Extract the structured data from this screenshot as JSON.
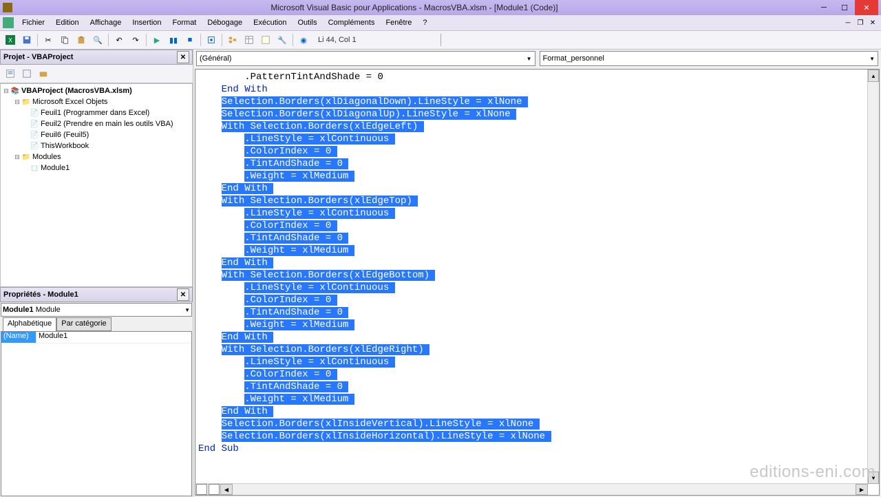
{
  "title": "Microsoft Visual Basic pour Applications - MacrosVBA.xlsm - [Module1 (Code)]",
  "menu": [
    "Fichier",
    "Edition",
    "Affichage",
    "Insertion",
    "Format",
    "Débogage",
    "Exécution",
    "Outils",
    "Compléments",
    "Fenêtre",
    "?"
  ],
  "cursor_status": "Li 44, Col 1",
  "project_panel": {
    "title": "Projet - VBAProject"
  },
  "tree": {
    "root": "VBAProject (MacrosVBA.xlsm)",
    "folder1": "Microsoft Excel Objets",
    "sheets": [
      "Feuil1 (Programmer dans Excel)",
      "Feuil2 (Prendre en main les outils VBA)",
      "Feuil6 (Feuil5)",
      "ThisWorkbook"
    ],
    "folder2": "Modules",
    "module": "Module1"
  },
  "props_panel": {
    "title": "Propriétés - Module1"
  },
  "props_combo": {
    "name": "Module1",
    "type": "Module"
  },
  "props_tabs": [
    "Alphabétique",
    "Par catégorie"
  ],
  "props_rows": [
    {
      "name": "(Name)",
      "value": "Module1"
    }
  ],
  "code_combos": {
    "left": "(Général)",
    "right": "Format_personnel"
  },
  "code": [
    {
      "indent": 8,
      "t": ".PatternTintAndShade = 0",
      "sel": false
    },
    {
      "indent": 4,
      "t": "End With",
      "sel": false,
      "kw": true
    },
    {
      "indent": 4,
      "t": "Selection.Borders(xlDiagonalDown).LineStyle = xlNone",
      "sel": true
    },
    {
      "indent": 4,
      "t": "Selection.Borders(xlDiagonalUp).LineStyle = xlNone",
      "sel": true
    },
    {
      "indent": 4,
      "t": "With Selection.Borders(xlEdgeLeft)",
      "sel": true
    },
    {
      "indent": 8,
      "t": ".LineStyle = xlContinuous",
      "sel": true
    },
    {
      "indent": 8,
      "t": ".ColorIndex = 0",
      "sel": true
    },
    {
      "indent": 8,
      "t": ".TintAndShade = 0",
      "sel": true
    },
    {
      "indent": 8,
      "t": ".Weight = xlMedium",
      "sel": true
    },
    {
      "indent": 4,
      "t": "End With",
      "sel": true
    },
    {
      "indent": 4,
      "t": "With Selection.Borders(xlEdgeTop)",
      "sel": true
    },
    {
      "indent": 8,
      "t": ".LineStyle = xlContinuous",
      "sel": true
    },
    {
      "indent": 8,
      "t": ".ColorIndex = 0",
      "sel": true
    },
    {
      "indent": 8,
      "t": ".TintAndShade = 0",
      "sel": true
    },
    {
      "indent": 8,
      "t": ".Weight = xlMedium",
      "sel": true
    },
    {
      "indent": 4,
      "t": "End With",
      "sel": true
    },
    {
      "indent": 4,
      "t": "With Selection.Borders(xlEdgeBottom)",
      "sel": true
    },
    {
      "indent": 8,
      "t": ".LineStyle = xlContinuous",
      "sel": true
    },
    {
      "indent": 8,
      "t": ".ColorIndex = 0",
      "sel": true
    },
    {
      "indent": 8,
      "t": ".TintAndShade = 0",
      "sel": true
    },
    {
      "indent": 8,
      "t": ".Weight = xlMedium",
      "sel": true
    },
    {
      "indent": 4,
      "t": "End With",
      "sel": true
    },
    {
      "indent": 4,
      "t": "With Selection.Borders(xlEdgeRight)",
      "sel": true
    },
    {
      "indent": 8,
      "t": ".LineStyle = xlContinuous",
      "sel": true
    },
    {
      "indent": 8,
      "t": ".ColorIndex = 0",
      "sel": true
    },
    {
      "indent": 8,
      "t": ".TintAndShade = 0",
      "sel": true
    },
    {
      "indent": 8,
      "t": ".Weight = xlMedium",
      "sel": true
    },
    {
      "indent": 4,
      "t": "End With",
      "sel": true
    },
    {
      "indent": 4,
      "t": "Selection.Borders(xlInsideVertical).LineStyle = xlNone",
      "sel": true
    },
    {
      "indent": 4,
      "t": "Selection.Borders(xlInsideHorizontal).LineStyle = xlNone",
      "sel": true
    },
    {
      "indent": 0,
      "t": "End Sub",
      "sel": false,
      "kw": true
    }
  ],
  "watermark": "editions-eni.com"
}
